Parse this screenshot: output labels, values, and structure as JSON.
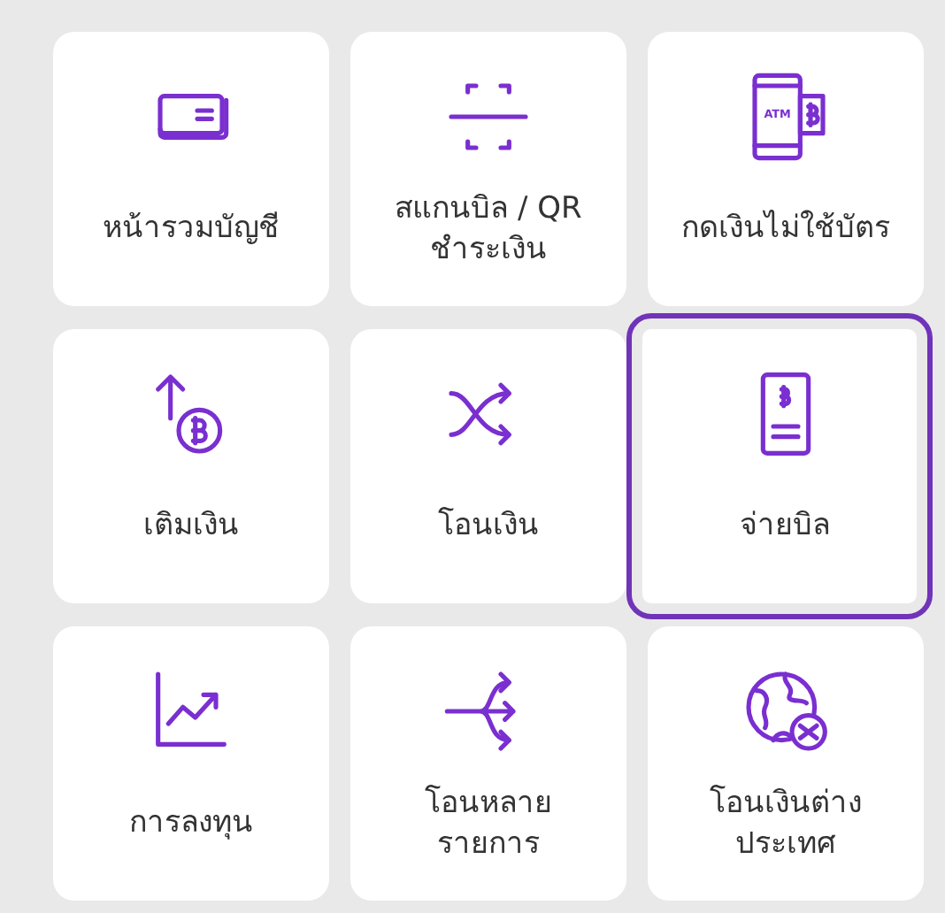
{
  "tiles": [
    {
      "kind": "accounts",
      "label": "หน้ารวมบัญชี",
      "selected": false
    },
    {
      "kind": "scan",
      "label": "สแกนบิล / QR\nชำระเงิน",
      "selected": false
    },
    {
      "kind": "atm",
      "icon_text": "ATM",
      "label": "กดเงินไม่ใช้บัตร",
      "selected": false
    },
    {
      "kind": "topup",
      "label": "เติมเงิน",
      "selected": false
    },
    {
      "kind": "transfer",
      "label": "โอนเงิน",
      "selected": false
    },
    {
      "kind": "bill",
      "label": "จ่ายบิล",
      "selected": true
    },
    {
      "kind": "invest",
      "label": "การลงทุน",
      "selected": false
    },
    {
      "kind": "multi",
      "label": "โอนหลาย\nรายการ",
      "selected": false
    },
    {
      "kind": "global",
      "label": "โอนเงินต่าง\nประเทศ",
      "selected": false
    }
  ]
}
